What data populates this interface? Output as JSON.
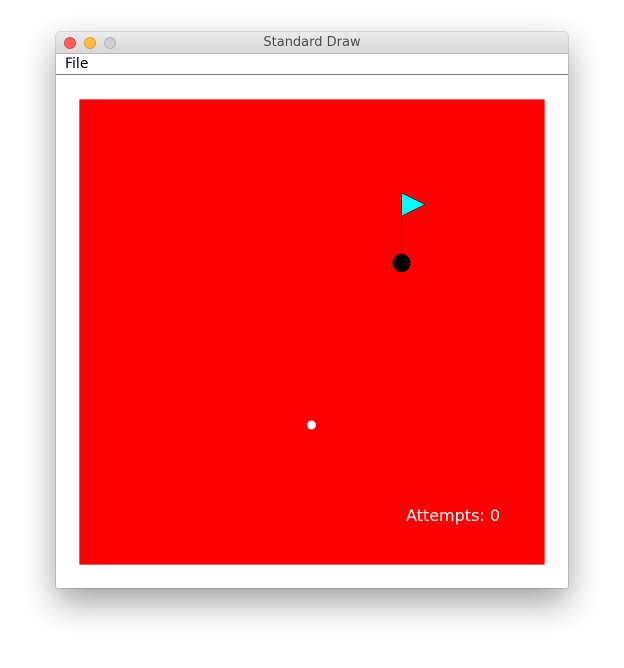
{
  "window": {
    "title": "Standard Draw"
  },
  "menu": {
    "items": [
      "File"
    ]
  },
  "game": {
    "background_color": "#ff0000",
    "flag_color": "#00ffff",
    "hole_color": "#000000",
    "ball_color": "#ffffff",
    "attempts_label": "Attempts: 0"
  }
}
